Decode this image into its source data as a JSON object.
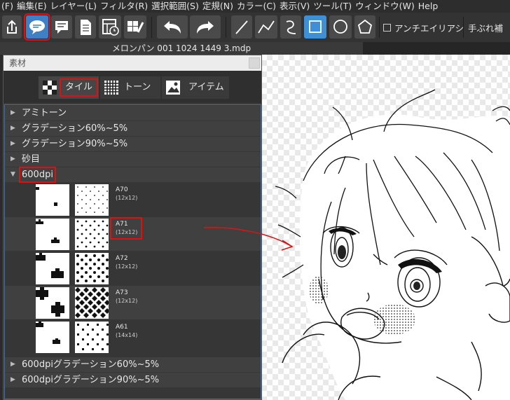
{
  "menubar": {
    "items": [
      "(F)",
      "編集(E)",
      "レイヤー(L)",
      "フィルタ(R)",
      "選択範囲(S)",
      "定規(N)",
      "カラー(C)",
      "表示(V)",
      "ツール(T)",
      "ウィンドウ(W)",
      "Help"
    ]
  },
  "toolbar": {
    "buttons": [
      "share-icon",
      "speech-balloon-icon",
      "chat-icon",
      "document-icon",
      "layout-icon",
      "edit-grid-icon",
      "undo-icon",
      "redo-icon",
      "line-icon",
      "polyline-icon",
      "curve-icon",
      "rectangle-icon",
      "ellipse-icon",
      "polygon-icon"
    ],
    "antialias_label": "アンチエイリアシ",
    "stabilizer_label": "手ぶれ補"
  },
  "document": {
    "tab_title": "メロンパン 001 1024 1449 3.mdp"
  },
  "material_panel": {
    "title": "素材",
    "tabs": [
      {
        "label": "タイル",
        "icon": "tile-icon",
        "selected": true
      },
      {
        "label": "トーン",
        "icon": "tone-icon",
        "selected": false
      },
      {
        "label": "アイテム",
        "icon": "item-icon",
        "selected": false
      }
    ],
    "tree": {
      "groups_top": [
        "アミトーン",
        "グラデーション60%~5%",
        "グラデーション90%~5%",
        "砂目"
      ],
      "expanded_group": "600dpi",
      "materials": [
        {
          "name": "A70",
          "size": "(12x12)"
        },
        {
          "name": "A71",
          "size": "(12x12)"
        },
        {
          "name": "A72",
          "size": "(12x12)"
        },
        {
          "name": "A73",
          "size": "(12x12)"
        },
        {
          "name": "A61",
          "size": "(14x14)"
        }
      ],
      "groups_bottom": [
        "600dpiグラデーション60%~5%",
        "600dpiグラデーション90%~5%"
      ]
    }
  },
  "colors": {
    "accent_blue": "#3e7fc6",
    "highlight_red": "#e01010",
    "arrow_red": "#d01818"
  }
}
